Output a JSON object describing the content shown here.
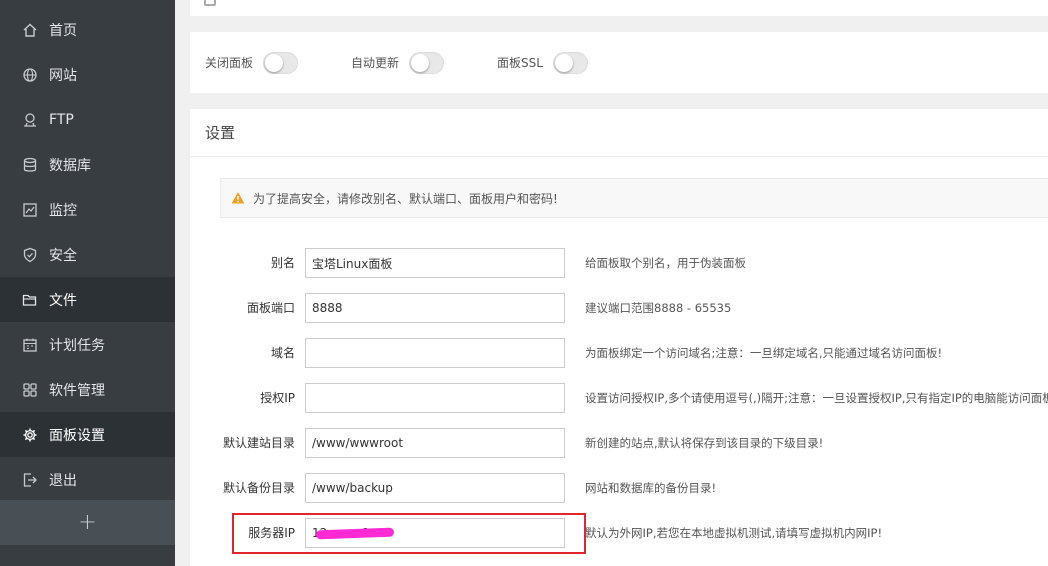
{
  "sidebar": {
    "items": [
      {
        "label": "首页",
        "icon": "home-icon"
      },
      {
        "label": "网站",
        "icon": "globe-icon"
      },
      {
        "label": "FTP",
        "icon": "ftp-icon"
      },
      {
        "label": "数据库",
        "icon": "database-icon"
      },
      {
        "label": "监控",
        "icon": "monitor-icon"
      },
      {
        "label": "安全",
        "icon": "shield-icon"
      },
      {
        "label": "文件",
        "icon": "folder-icon"
      },
      {
        "label": "计划任务",
        "icon": "calendar-icon"
      },
      {
        "label": "软件管理",
        "icon": "grid-icon"
      },
      {
        "label": "面板设置",
        "icon": "gear-icon"
      },
      {
        "label": "退出",
        "icon": "logout-icon"
      }
    ],
    "add_label": "+"
  },
  "toggles": [
    {
      "label": "关闭面板",
      "on": false
    },
    {
      "label": "自动更新",
      "on": false
    },
    {
      "label": "面板SSL",
      "on": false
    }
  ],
  "settings": {
    "title": "设置",
    "notice": "为了提高安全，请修改别名、默认端口、面板用户和密码!",
    "warning_color": "#f0a020",
    "fields": [
      {
        "label": "别名",
        "value": "宝塔Linux面板",
        "help": "给面板取个别名，用于伪装面板"
      },
      {
        "label": "面板端口",
        "value": "8888",
        "help": "建议端口范围8888 - 65535"
      },
      {
        "label": "域名",
        "value": "",
        "help": "为面板绑定一个访问域名;注意：一旦绑定域名,只能通过域名访问面板!"
      },
      {
        "label": "授权IP",
        "value": "",
        "help": "设置访问授权IP,多个请使用逗号(,)隔开;注意：一旦设置授权IP,只有指定IP的电脑能访问面板!"
      },
      {
        "label": "默认建站目录",
        "value": "/www/wwwroot",
        "help": "新创建的站点,默认将保存到该目录的下级目录!"
      },
      {
        "label": "默认备份目录",
        "value": "/www/backup",
        "help": "网站和数据库的备份目录!"
      },
      {
        "label": "服务器IP",
        "value": "12·········8",
        "help": "默认为外网IP,若您在本地虚拟机测试,请填写虚拟机内网IP!"
      }
    ]
  },
  "colors": {
    "sidebar_bg": "#373d41",
    "sidebar_active": "#2c3135",
    "highlight": "#e0252f",
    "redaction": "#ff2ad4"
  }
}
